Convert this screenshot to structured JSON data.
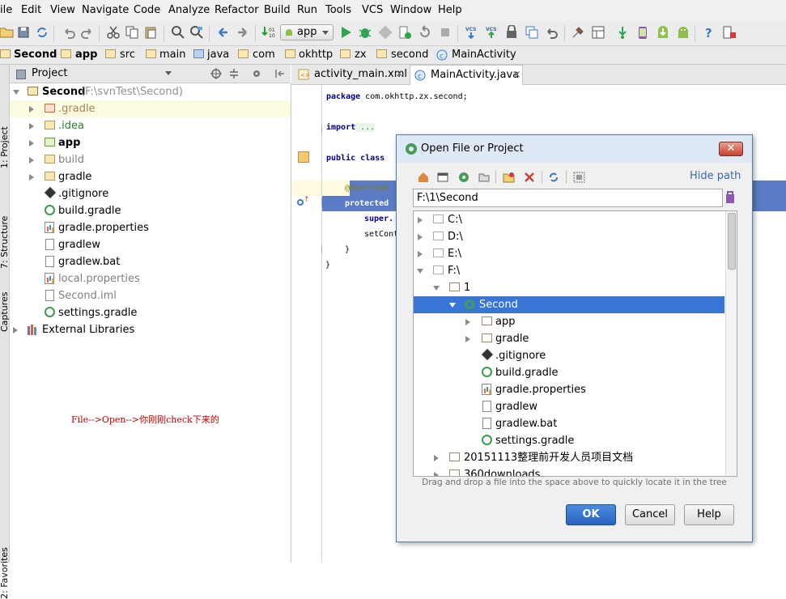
{
  "menu": [
    "ile",
    "Edit",
    "View",
    "Navigate",
    "Code",
    "Analyze",
    "Refactor",
    "Build",
    "Run",
    "Tools",
    "VCS",
    "Window",
    "Help"
  ],
  "toolbar": {
    "run_config": "app"
  },
  "breadcrumb": [
    "Second",
    "app",
    "src",
    "main",
    "java",
    "com",
    "okhttp",
    "zx",
    "second",
    "MainActivity"
  ],
  "left_strip": {
    "project": "1: Project",
    "structure": "7: Structure",
    "captures": "Captures",
    "favorites": "2: Favorites"
  },
  "project_panel": {
    "header": "Project",
    "root": {
      "name": "Second",
      "path": "(F:\\svnTest\\Second)"
    },
    "items": [
      {
        "label": ".gradle",
        "type": "folder"
      },
      {
        "label": ".idea",
        "type": "folder"
      },
      {
        "label": "app",
        "type": "module"
      },
      {
        "label": "build",
        "type": "folder"
      },
      {
        "label": "gradle",
        "type": "folder"
      },
      {
        "label": ".gitignore",
        "type": "git"
      },
      {
        "label": "build.gradle",
        "type": "gradle"
      },
      {
        "label": "gradle.properties",
        "type": "properties"
      },
      {
        "label": "gradlew",
        "type": "file"
      },
      {
        "label": "gradlew.bat",
        "type": "file"
      },
      {
        "label": "local.properties",
        "type": "properties"
      },
      {
        "label": "Second.iml",
        "type": "file"
      },
      {
        "label": "settings.gradle",
        "type": "gradle"
      }
    ],
    "external": "External Libraries",
    "annotation": "File-->Open-->你刚刚check下来的"
  },
  "editor": {
    "tabs": [
      {
        "label": "activity_main.xml",
        "active": false
      },
      {
        "label": "MainActivity.java",
        "active": true
      }
    ],
    "code": {
      "package_kw": "package",
      "package_name": " com.okhttp.zx.second;",
      "import_kw": "import",
      "import_rest": " ...",
      "class_kw": "public class",
      "override": "@Override",
      "protected_kw": "protected",
      "super_kw": "super.",
      "setcontent": "setCont",
      "brace_inner": "}",
      "brace_outer": "}"
    }
  },
  "dialog": {
    "title": "Open File or Project",
    "hide_path": "Hide path",
    "path_value": "F:\\1\\Second",
    "tree": [
      {
        "label": "C:\\",
        "type": "drive"
      },
      {
        "label": "D:\\",
        "type": "drive"
      },
      {
        "label": "E:\\",
        "type": "drive"
      },
      {
        "label": "F:\\",
        "type": "drive"
      },
      {
        "label": "1",
        "type": "folder"
      },
      {
        "label": "Second",
        "type": "project"
      },
      {
        "label": "app",
        "type": "folder"
      },
      {
        "label": "gradle",
        "type": "folder"
      },
      {
        "label": ".gitignore",
        "type": "git"
      },
      {
        "label": "build.gradle",
        "type": "gradle"
      },
      {
        "label": "gradle.properties",
        "type": "properties"
      },
      {
        "label": "gradlew",
        "type": "file"
      },
      {
        "label": "gradlew.bat",
        "type": "file"
      },
      {
        "label": "settings.gradle",
        "type": "gradle"
      },
      {
        "label": "20151113整理前开发人员项目文档",
        "type": "folder"
      },
      {
        "label": "360downloads",
        "type": "folder"
      }
    ],
    "hint": "Drag and drop a file into the space above to quickly locate it in the tree",
    "ok": "OK",
    "cancel": "Cancel",
    "help": "Help"
  },
  "colors": {
    "selection": "#3875d7",
    "editor_selection": "#5b7bc7",
    "annotation": "#c00000",
    "keyword": "#000080"
  }
}
